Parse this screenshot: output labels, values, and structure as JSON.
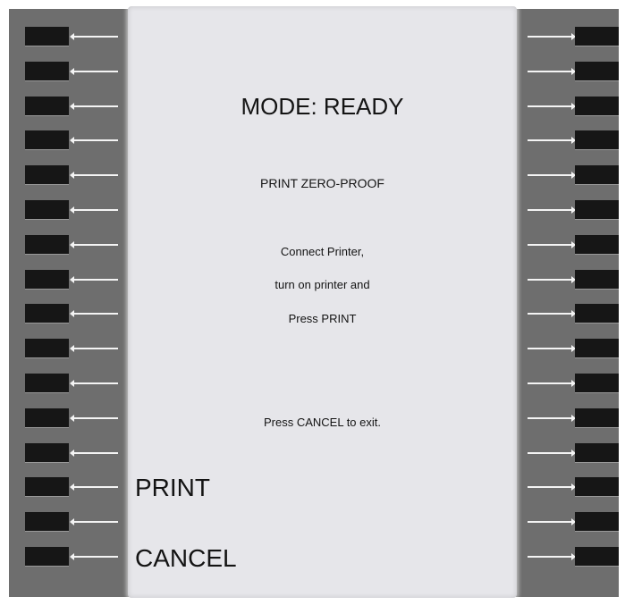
{
  "screen": {
    "mode_label": "MODE: READY",
    "subtitle": "PRINT ZERO-PROOF",
    "instructions": [
      "Connect Printer,",
      "turn on printer and",
      "Press PRINT"
    ],
    "exit_hint": "Press CANCEL to exit."
  },
  "softkeys": {
    "print_label": "PRINT",
    "cancel_label": "CANCEL"
  },
  "bezel": {
    "left_key_count": 16,
    "right_key_count": 16
  },
  "colors": {
    "bezel": "#6e6e6e",
    "screen": "#e6e6ea",
    "key": "#161616",
    "arrow": "#f4f4f4",
    "text": "#141414"
  }
}
